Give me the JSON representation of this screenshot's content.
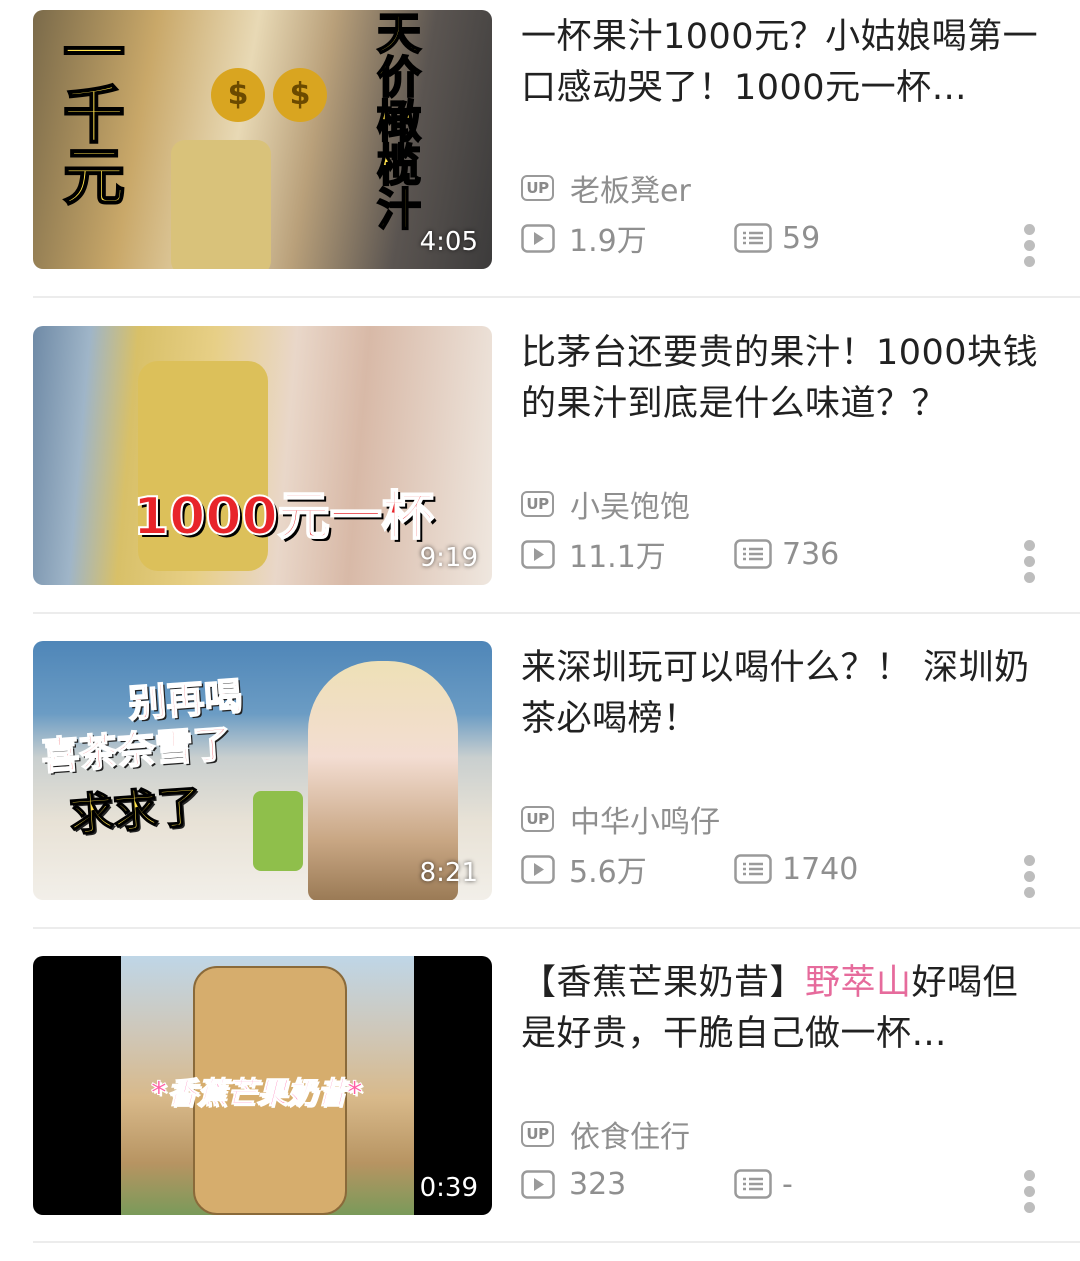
{
  "videos": [
    {
      "title": "一杯果汁1000元？小姑娘喝第一口感动哭了！1000元一杯…",
      "title_highlight": "",
      "title_after": "",
      "duration": "4:05",
      "up_label": "UP",
      "author": "老板凳er",
      "views": "1.9万",
      "danmaku": "59",
      "thumb_overlay": [
        "一千元",
        "天价橄榄汁"
      ]
    },
    {
      "title": "比茅台还要贵的果汁！1000块钱的果汁到底是什么味道？？",
      "title_highlight": "",
      "title_after": "",
      "duration": "9:19",
      "up_label": "UP",
      "author": "小吴饱饱",
      "views": "11.1万",
      "danmaku": "736",
      "thumb_overlay": [
        "1000元一杯"
      ]
    },
    {
      "title": "来深圳玩可以喝什么？！ 深圳奶茶必喝榜！",
      "title_highlight": "",
      "title_after": "",
      "duration": "8:21",
      "up_label": "UP",
      "author": "中华小鸣仔",
      "views": "5.6万",
      "danmaku": "1740",
      "thumb_overlay": [
        "别再喝",
        "喜茶奈雪了",
        "求求了"
      ]
    },
    {
      "title": "【香蕉芒果奶昔】",
      "title_highlight": "野萃山",
      "title_after": "好喝但是好贵，干脆自己做一杯…",
      "duration": "0:39",
      "up_label": "UP",
      "author": "依食住行",
      "views": "323",
      "danmaku": "-",
      "thumb_overlay": [
        "*香蕉芒果奶昔*"
      ]
    }
  ],
  "colors": {
    "highlight": "#e66b9c",
    "meta": "#8f8f8f",
    "divider": "#ececec"
  }
}
